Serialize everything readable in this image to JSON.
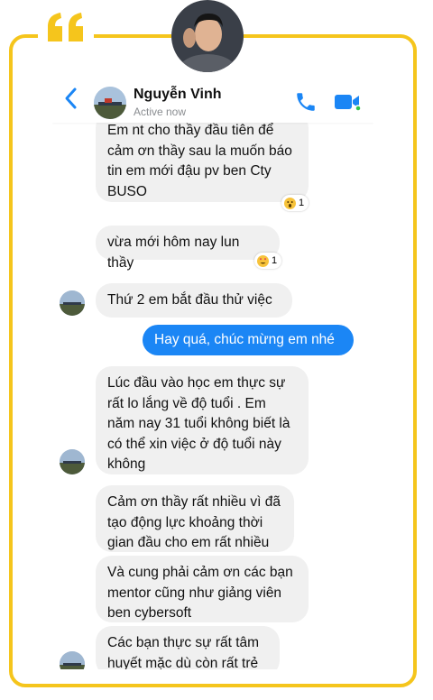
{
  "contact": {
    "name": "Nguyễn Vinh",
    "status": "Active now"
  },
  "messages": [
    {
      "id": "m1",
      "direction": "in",
      "text": "Em nt cho thầy đầu tiên để\ncảm ơn thầy sau la muốn báo\ntin em mới đậu pv ben Cty\nBUSO",
      "reaction": {
        "icon": "surprised-face",
        "count": "1"
      }
    },
    {
      "id": "m2",
      "direction": "in",
      "text": "vừa mới hôm nay lun thầy",
      "reaction": {
        "icon": "heart-eyes-face",
        "count": "1"
      }
    },
    {
      "id": "m3",
      "direction": "in",
      "text": "Thứ 2 em bắt đầu thử việc"
    },
    {
      "id": "m4",
      "direction": "out",
      "text": "Hay quá, chúc mừng em nhé"
    },
    {
      "id": "m5",
      "direction": "in",
      "text": "Lúc đầu vào học em thực sự\nrất lo lắng về độ tuổi . Em\nnăm nay 31 tuổi không biết là\ncó thể xin việc ở độ tuổi này\nkhông"
    },
    {
      "id": "m6",
      "direction": "in",
      "text": "Cảm ơn thầy rất nhiều vì đã\ntạo động lực khoảng thời\ngian đầu cho em rất nhiều"
    },
    {
      "id": "m7",
      "direction": "in",
      "text": "Và cung phải cảm ơn các bạn\nmentor cũng như giảng viên\nben cybersoft"
    },
    {
      "id": "m8",
      "direction": "in",
      "text": "Các bạn thực sự rất tâm\nhuyết mặc dù còn rất trẻ"
    }
  ],
  "colors": {
    "frame": "#f5c51c",
    "messenger_blue": "#1b86f5",
    "incoming_bubble": "#f0f0f0"
  }
}
